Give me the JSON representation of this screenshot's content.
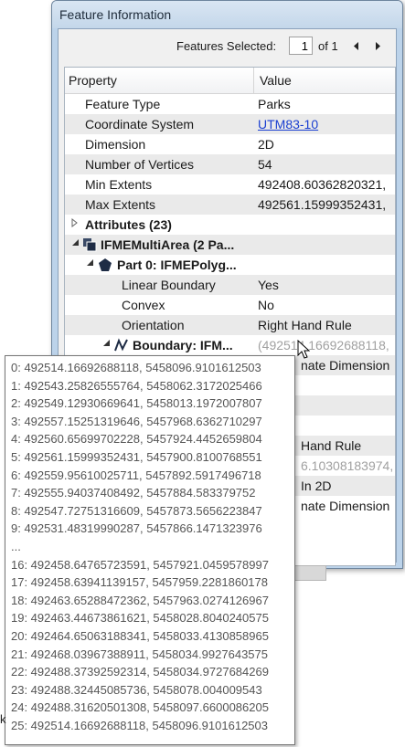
{
  "window": {
    "title": "Feature Information"
  },
  "toolbar": {
    "features_selected_label": "Features Selected:",
    "current_value": "1",
    "of_total": "of 1",
    "prev_icon": "triangle-left",
    "next_icon": "triangle-right"
  },
  "table": {
    "headers": {
      "property": "Property",
      "value": "Value"
    },
    "rows": [
      {
        "property": "Feature Type",
        "value": "Parks"
      },
      {
        "property": "Coordinate System",
        "value": "UTM83-10"
      },
      {
        "property": "Dimension",
        "value": "2D"
      },
      {
        "property": "Number of Vertices",
        "value": "54"
      },
      {
        "property": "Min Extents",
        "value": "492408.60362820321,"
      },
      {
        "property": "Max Extents",
        "value": "492561.15999352431,"
      },
      {
        "property": "Attributes (23)",
        "value": ""
      },
      {
        "property": "IFMEMultiArea (2 Pa...",
        "value": ""
      },
      {
        "property": "Part 0: IFMEPolyg...",
        "value": ""
      },
      {
        "property": "Linear Boundary",
        "value": "Yes"
      },
      {
        "property": "Convex",
        "value": "No"
      },
      {
        "property": "Orientation",
        "value": "Right Hand Rule"
      },
      {
        "property": "Boundary: IFM...",
        "value": "(492514.16692688118,"
      }
    ],
    "hidden_partial": [
      "nate Dimension",
      "Hand Rule",
      "6.10308183974,",
      "In 2D",
      "nate Dimension"
    ]
  },
  "tooltip": {
    "lines": [
      "0: 492514.16692688118, 5458096.9101612503",
      "1: 492543.25826555764, 5458062.3172025466",
      "2: 492549.12930669641, 5458013.1972007807",
      "3: 492557.15251319646, 5457968.6362710297",
      "4: 492560.65699702228, 5457924.4452659804",
      "5: 492561.15999352431, 5457900.8100768551",
      "6: 492559.95610025711, 5457892.5917496718",
      "7: 492555.94037408492, 5457884.583379752",
      "8: 492547.72751316609, 5457873.5656223847",
      "9: 492531.48319990287, 5457866.1471323976",
      "...",
      "16: 492458.64765723591, 5457921.0459578997",
      "17: 492458.63941139157, 5457959.2281860178",
      "18: 492463.65288472362, 5457963.0274126967",
      "19: 492463.44673861621, 5458028.8040240575",
      "20: 492464.65063188341, 5458033.4130858965",
      "21: 492468.03967388911, 5458034.9927643575",
      "22: 492488.37392592314, 5458034.9727684269",
      "23: 492488.32445085736, 5458078.004009543",
      "24: 492488.31620501308, 5458097.6600086205",
      "25: 492514.16692688118, 5458096.9101612503"
    ]
  },
  "edge_char": "k"
}
